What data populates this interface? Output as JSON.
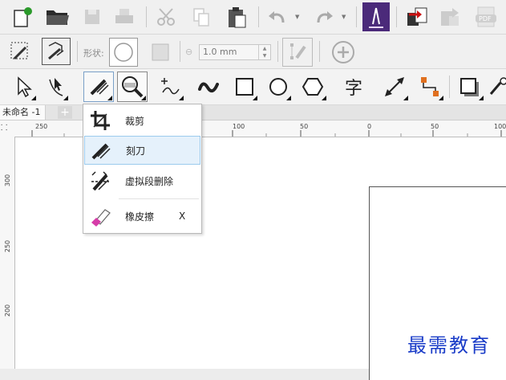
{
  "document": {
    "tab_name": "未命名 -1",
    "add_tab": "+"
  },
  "property_bar": {
    "shape_label": "形状:",
    "outline_width": "1.0 mm"
  },
  "toolbox": {
    "text_tool_glyph": "字"
  },
  "menu": {
    "items": [
      {
        "label": "裁剪",
        "shortcut": ""
      },
      {
        "label": "刻刀",
        "shortcut": ""
      },
      {
        "label": "虚拟段删除",
        "shortcut": ""
      },
      {
        "label": "橡皮擦",
        "shortcut": "X"
      }
    ]
  },
  "rulers": {
    "horizontal": [
      "250",
      "100",
      "50",
      "0",
      "50",
      "100"
    ],
    "vertical": [
      "300",
      "250",
      "200"
    ]
  },
  "watermark": "最需教育",
  "colors": {
    "accent_purple": "#4b2a7a",
    "eraser_pink": "#d63ca8",
    "red_arrow": "#cc1111",
    "orange_node": "#e07020"
  }
}
